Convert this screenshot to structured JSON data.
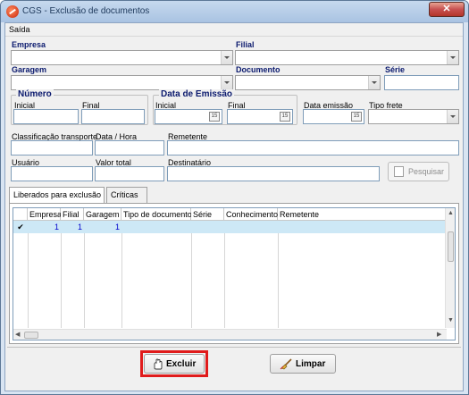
{
  "window": {
    "title": "CGS - Exclusão de documentos",
    "close_glyph": "✕"
  },
  "menu": {
    "saida": "Saída"
  },
  "labels": {
    "empresa": "Empresa",
    "filial": "Filial",
    "garagem": "Garagem",
    "documento": "Documento",
    "serie": "Série",
    "numero": "Número",
    "inicial": "Inicial",
    "final": "Final",
    "data_emissao_group": "Data de Emissão",
    "data_emissao": "Data emissão",
    "tipo_frete": "Tipo frete",
    "classificacao_transporte": "Classificação transporte",
    "data_hora": "Data / Hora",
    "remetente": "Remetente",
    "usuario": "Usuário",
    "valor_total": "Valor total",
    "destinatario": "Destinatário"
  },
  "date_icon_text": "15",
  "buttons": {
    "pesquisar": "Pesquisar",
    "excluir": "Excluir",
    "limpar": "Limpar"
  },
  "tabs": [
    "Liberados para exclusão",
    "Críticas"
  ],
  "grid": {
    "columns": [
      "Empresa",
      "Filial",
      "Garagem",
      "Tipo de documento",
      "Série",
      "Conhecimento",
      "Remetente"
    ],
    "rows": [
      {
        "checked": "✔",
        "empresa": "1",
        "filial": "1",
        "garagem": "1",
        "tipo_documento": "",
        "serie": "",
        "conhecimento": "",
        "remetente": ""
      }
    ]
  },
  "colors": {
    "accent": "#0b1a6e",
    "highlight": "#e01b1b",
    "row_selected": "#cde8f6"
  }
}
